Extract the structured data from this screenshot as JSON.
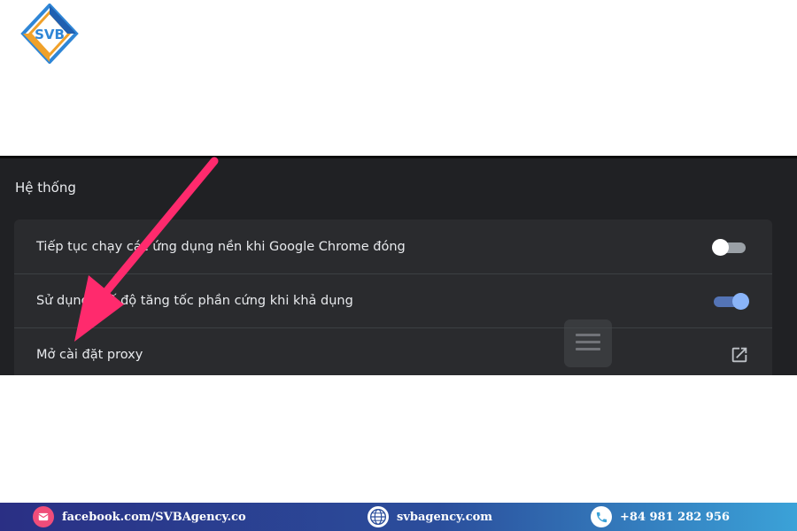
{
  "logo": {
    "text": "SVB",
    "icon": "svb-logo"
  },
  "settings": {
    "section_title": "Hệ thống",
    "rows": [
      {
        "label": "Tiếp tục chạy các ứng dụng nền khi Google Chrome đóng",
        "control": "toggle",
        "state": "off"
      },
      {
        "label": "Sử dụng chế độ tăng tốc phần cứng khi khả dụng",
        "control": "toggle",
        "state": "on"
      },
      {
        "label": "Mở cài đặt proxy",
        "control": "launch-icon"
      }
    ]
  },
  "overlay": {
    "icon": "menu-icon"
  },
  "annotation": {
    "icon": "pointer-arrow",
    "color": "#ff2a6d"
  },
  "footer": {
    "facebook": {
      "icon": "messenger-icon",
      "text": "facebook.com/SVBAgency.co"
    },
    "website": {
      "icon": "globe-icon",
      "text": "svbagency.com"
    },
    "phone": {
      "icon": "phone-icon",
      "text": "+84 981 282 956"
    }
  },
  "colors": {
    "panel_bg": "#202124",
    "card_bg": "#2a2b2e",
    "toggle_on": "#8ab4f8",
    "footer_start": "#2a2f84",
    "footer_end": "#3ba2d8"
  }
}
